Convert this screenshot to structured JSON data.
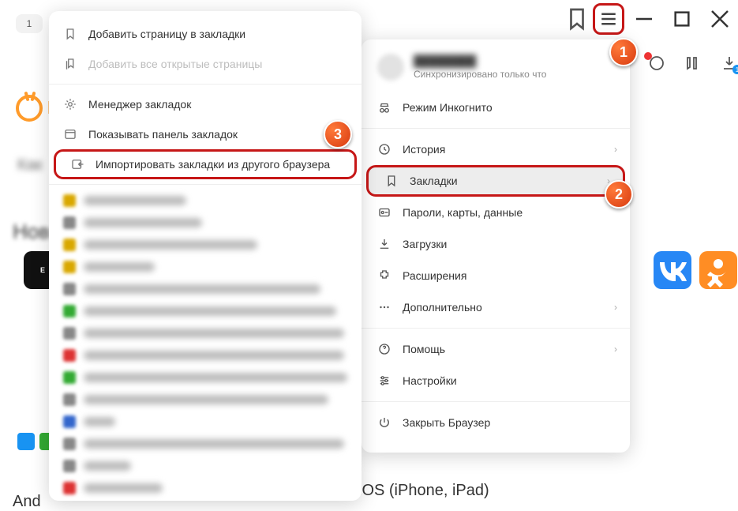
{
  "window": {
    "tab_index": "1",
    "download_badge": "1"
  },
  "background": {
    "logo_fragment": "l",
    "heading1": "Как",
    "heading2": "Нов",
    "footer_left": "And",
    "footer_mid": "iOS (iPhone, iPad)"
  },
  "main_menu": {
    "sync_status": "Синхронизировано только что",
    "incognito": "Режим Инкогнито",
    "history": "История",
    "bookmarks": "Закладки",
    "passwords": "Пароли, карты, данные",
    "downloads": "Загрузки",
    "extensions": "Расширения",
    "more": "Дополнительно",
    "help": "Помощь",
    "settings": "Настройки",
    "close": "Закрыть Браузер"
  },
  "sub_menu": {
    "add_page": "Добавить страницу в закладки",
    "add_all": "Добавить все открытые страницы",
    "manager": "Менеджер закладок",
    "show_bar": "Показывать панель закладок",
    "import": "Импортировать закладки из другого браузера"
  },
  "callouts": {
    "one": "1",
    "two": "2",
    "three": "3"
  }
}
